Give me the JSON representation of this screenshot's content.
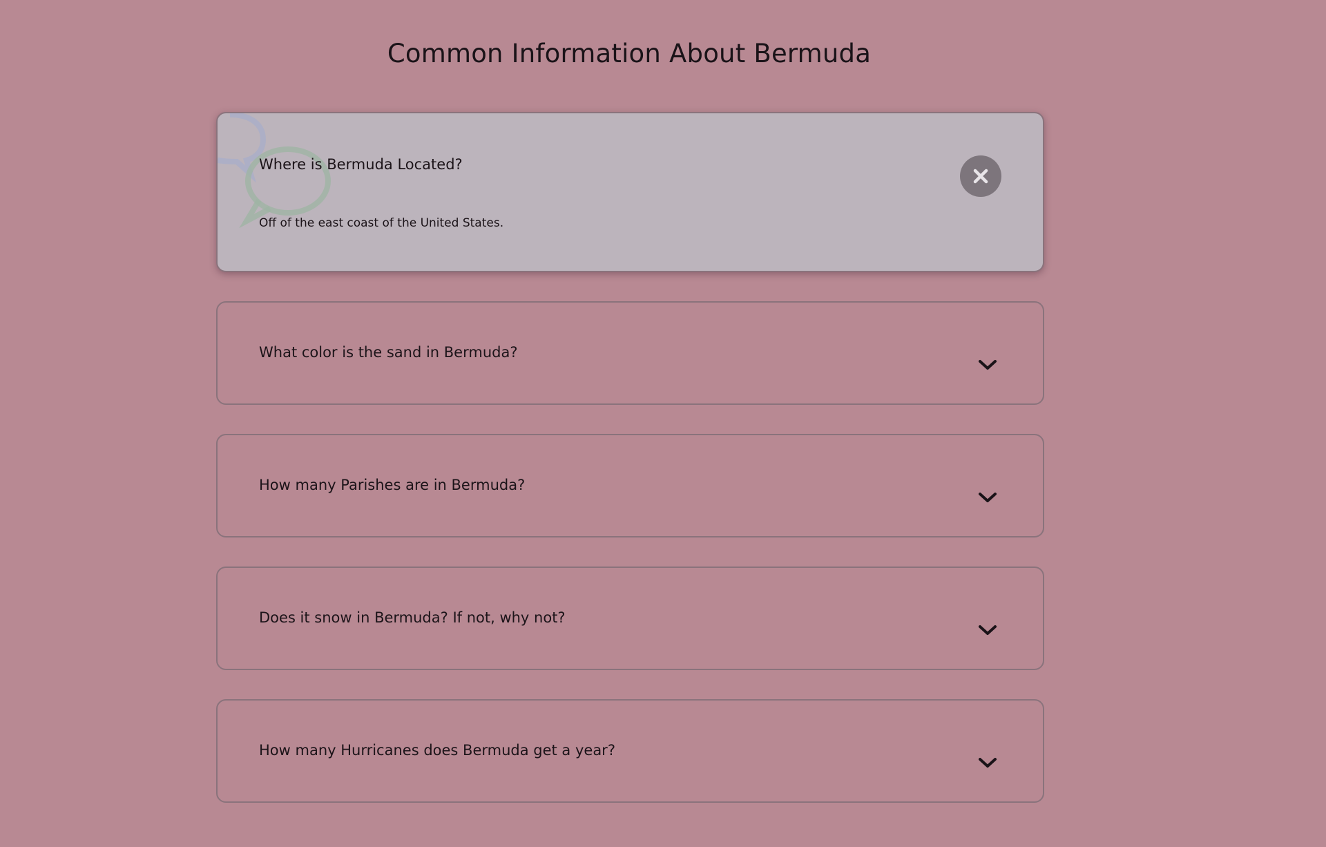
{
  "page": {
    "title": "Common Information About Bermuda"
  },
  "colors": {
    "background": "#b88993",
    "open_card": "#bcb4bc",
    "card_border": "#8a737c",
    "close_button": "#7d757c"
  },
  "faq": [
    {
      "question": "Where is Bermuda Located?",
      "answer": "Off of the east coast of the United States.",
      "state": "open",
      "toggle_icon": "close-icon"
    },
    {
      "question": "What color is the sand in Bermuda?",
      "state": "collapsed",
      "toggle_icon": "chevron-down-icon"
    },
    {
      "question": "How many Parishes are in Bermuda?",
      "state": "collapsed",
      "toggle_icon": "chevron-down-icon"
    },
    {
      "question": "Does it snow in Bermuda? If not, why not?",
      "state": "collapsed",
      "toggle_icon": "chevron-down-icon"
    },
    {
      "question": "How many Hurricanes does Bermuda get a year?",
      "state": "collapsed",
      "toggle_icon": "chevron-down-icon"
    }
  ]
}
